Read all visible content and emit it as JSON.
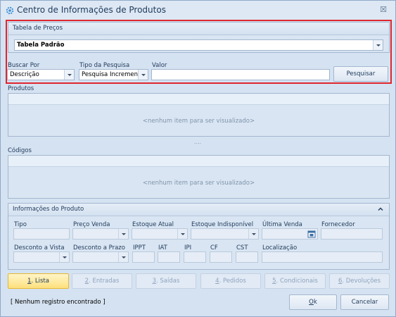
{
  "window": {
    "title": "Centro de Informações de Produtos",
    "close_glyph": "☒"
  },
  "price_table": {
    "group_label": "Tabela de Preços",
    "value": "Tabela Padrão"
  },
  "search": {
    "buscar_por_label": "Buscar Por",
    "buscar_por_value": "Descrição",
    "tipo_pesquisa_label": "Tipo da Pesquisa",
    "tipo_pesquisa_value": "Pesquisa Incremental",
    "valor_label": "Valor",
    "valor_value": "",
    "button_label": "Pesquisar"
  },
  "produtos": {
    "label": "Produtos",
    "empty_text": "<nenhum item para ser visualizado>"
  },
  "splitter_glyph": "....",
  "codigos": {
    "label": "Códigos",
    "empty_text": "<nenhum item para ser visualizado>"
  },
  "info": {
    "group_label": "Informações do Produto",
    "fields": {
      "tipo": "Tipo",
      "preco_venda": "Preço Venda",
      "estoque_atual": "Estoque Atual",
      "estoque_indisponivel": "Estoque Indisponível",
      "ultima_venda": "Última Venda",
      "fornecedor": "Fornecedor",
      "desconto_vista": "Desconto a Vista",
      "desconto_prazo": "Desconto a Prazo",
      "ippt": "IPPT",
      "iat": "IAT",
      "ipi": "IPI",
      "cf": "CF",
      "cst": "CST",
      "localizacao": "Localização"
    }
  },
  "tabs": [
    {
      "key": "1",
      "label": ". Lista",
      "active": true
    },
    {
      "key": "2",
      "label": ". Entradas",
      "active": false
    },
    {
      "key": "3",
      "label": ". Saídas",
      "active": false
    },
    {
      "key": "4",
      "label": ". Pedidos",
      "active": false
    },
    {
      "key": "5",
      "label": ". Condicionais",
      "active": false
    },
    {
      "key": "6",
      "label": ". Devoluções",
      "active": false
    }
  ],
  "status_text": "[ Nenhum registro encontrado ]",
  "ok_key": "O",
  "ok_rest": "k",
  "cancel_label": "Cancelar",
  "colors": {
    "highlight_frame": "#e0262e",
    "active_tab": "#fde07d"
  }
}
